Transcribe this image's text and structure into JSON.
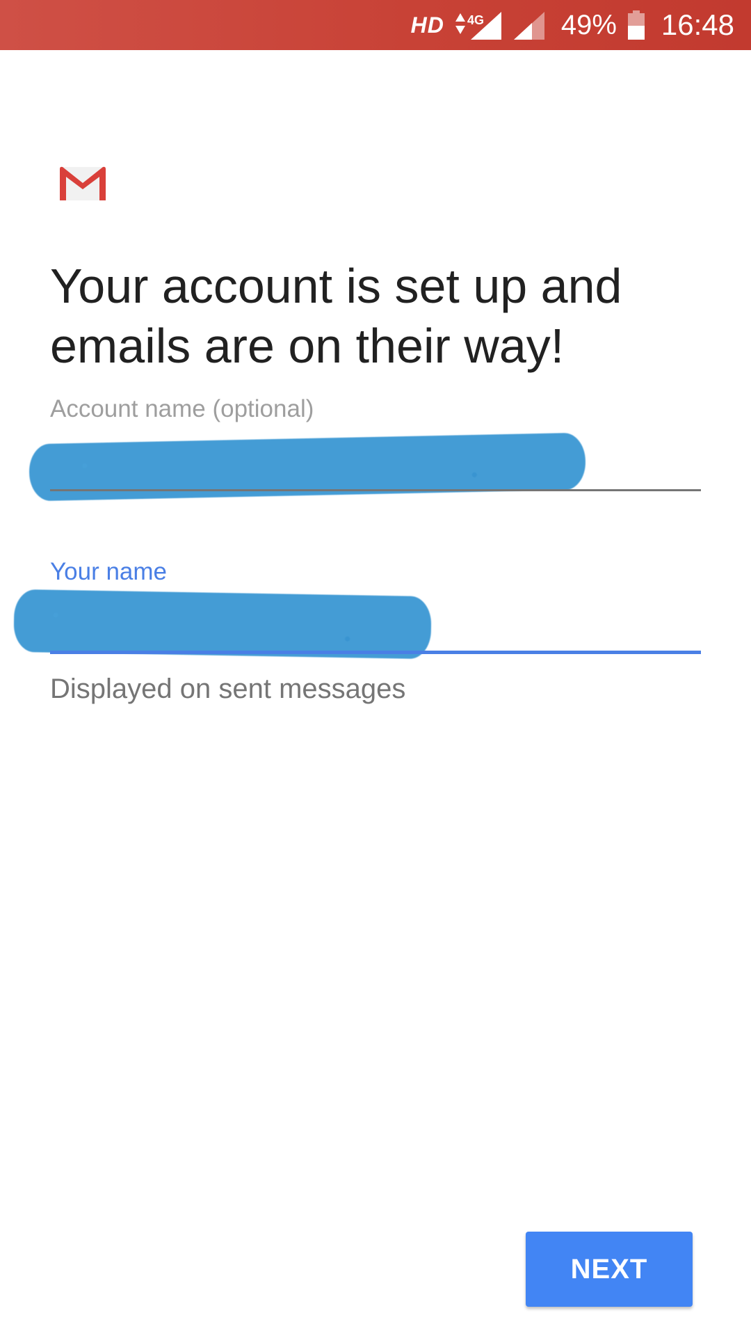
{
  "status_bar": {
    "network_label": "HD",
    "network_type": "4G",
    "battery_percent": "49%",
    "time": "16:48",
    "background_color": "#c84236"
  },
  "logo": {
    "icon": "gmail-logo-icon"
  },
  "headline": "Your account is set up and emails are on their way!",
  "account_name": {
    "label": "Account name (optional)",
    "value": ""
  },
  "your_name": {
    "label": "Your name",
    "value": "",
    "helper_text": "Displayed on sent messages",
    "accent_color": "#4a7fe5"
  },
  "actions": {
    "next_label": "NEXT",
    "button_color": "#4285f4"
  }
}
